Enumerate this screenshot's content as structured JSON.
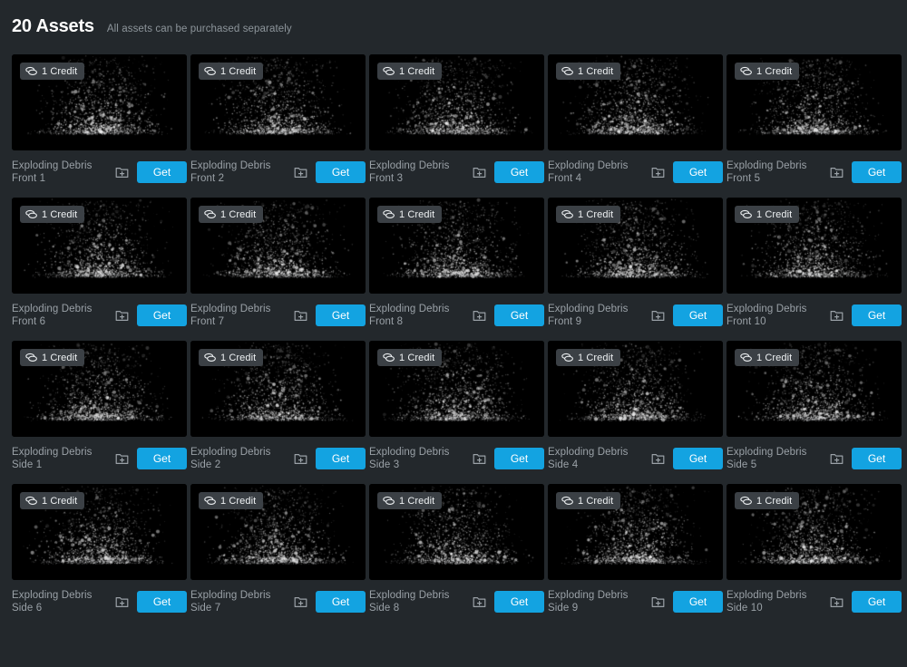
{
  "header": {
    "title": "20 Assets",
    "subtitle": "All assets can be purchased separately"
  },
  "labels": {
    "credit_badge": "1 Credit",
    "get_button": "Get",
    "coin_icon": "coin-stack-icon",
    "folder_add_icon": "folder-add-icon"
  },
  "colors": {
    "page_background": "#23282c",
    "thumb_background": "#000000",
    "badge_background": "#3b4045",
    "accent_blue": "#13a3e1",
    "title_text": "#ffffff",
    "subtitle_text": "#8d959b",
    "asset_name_text": "#9aa1a7"
  },
  "assets": [
    {
      "name": "Exploding Debris\nFront 1",
      "credit": "1 Credit",
      "action": "Get",
      "seed": 11
    },
    {
      "name": "Exploding Debris\nFront 2",
      "credit": "1 Credit",
      "action": "Get",
      "seed": 22
    },
    {
      "name": "Exploding Debris\nFront 3",
      "credit": "1 Credit",
      "action": "Get",
      "seed": 33
    },
    {
      "name": "Exploding Debris\nFront 4",
      "credit": "1 Credit",
      "action": "Get",
      "seed": 44
    },
    {
      "name": "Exploding Debris\nFront 5",
      "credit": "1 Credit",
      "action": "Get",
      "seed": 55
    },
    {
      "name": "Exploding Debris\nFront 6",
      "credit": "1 Credit",
      "action": "Get",
      "seed": 66
    },
    {
      "name": "Exploding Debris\nFront 7",
      "credit": "1 Credit",
      "action": "Get",
      "seed": 77
    },
    {
      "name": "Exploding Debris\nFront 8",
      "credit": "1 Credit",
      "action": "Get",
      "seed": 88
    },
    {
      "name": "Exploding Debris\nFront 9",
      "credit": "1 Credit",
      "action": "Get",
      "seed": 99
    },
    {
      "name": "Exploding Debris\nFront 10",
      "credit": "1 Credit",
      "action": "Get",
      "seed": 110
    },
    {
      "name": "Exploding Debris\nSide 1",
      "credit": "1 Credit",
      "action": "Get",
      "seed": 121
    },
    {
      "name": "Exploding Debris\nSide 2",
      "credit": "1 Credit",
      "action": "Get",
      "seed": 132
    },
    {
      "name": "Exploding Debris\nSide 3",
      "credit": "1 Credit",
      "action": "Get",
      "seed": 143
    },
    {
      "name": "Exploding Debris\nSide 4",
      "credit": "1 Credit",
      "action": "Get",
      "seed": 154
    },
    {
      "name": "Exploding Debris\nSide 5",
      "credit": "1 Credit",
      "action": "Get",
      "seed": 165
    },
    {
      "name": "Exploding Debris\nSide 6",
      "credit": "1 Credit",
      "action": "Get",
      "seed": 176
    },
    {
      "name": "Exploding Debris\nSide 7",
      "credit": "1 Credit",
      "action": "Get",
      "seed": 187
    },
    {
      "name": "Exploding Debris\nSide 8",
      "credit": "1 Credit",
      "action": "Get",
      "seed": 198
    },
    {
      "name": "Exploding Debris\nSide 9",
      "credit": "1 Credit",
      "action": "Get",
      "seed": 209
    },
    {
      "name": "Exploding Debris\nSide 10",
      "credit": "1 Credit",
      "action": "Get",
      "seed": 220
    }
  ]
}
